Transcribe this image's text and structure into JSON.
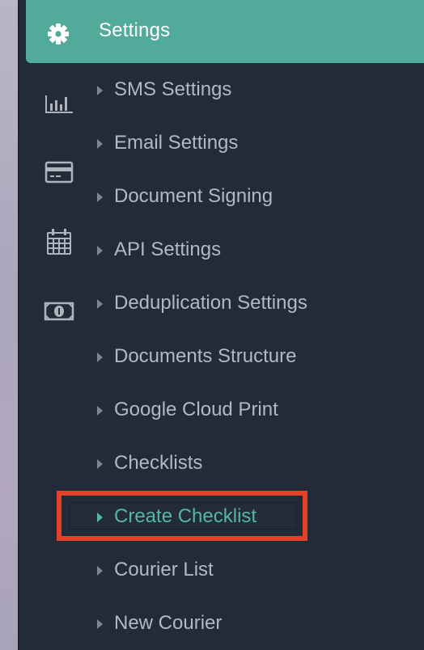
{
  "colors": {
    "sidebar_bg": "#232b39",
    "header_bg": "#52ab9a",
    "menu_text": "#b3b8c2",
    "active_text": "#52b8a4",
    "highlight_border": "#e5402a"
  },
  "header": {
    "title": "Settings",
    "icon": "gear-icon"
  },
  "side_icons": [
    "bar-chart-icon",
    "credit-card-icon",
    "calendar-icon",
    "money-bill-icon"
  ],
  "menu": {
    "items": [
      {
        "label": "SMS Settings",
        "active": false
      },
      {
        "label": "Email Settings",
        "active": false
      },
      {
        "label": "Document Signing",
        "active": false
      },
      {
        "label": "API Settings",
        "active": false
      },
      {
        "label": "Deduplication Settings",
        "active": false
      },
      {
        "label": "Documents Structure",
        "active": false
      },
      {
        "label": "Google Cloud Print",
        "active": false
      },
      {
        "label": "Checklists",
        "active": false
      },
      {
        "label": "Create Checklist",
        "active": true
      },
      {
        "label": "Courier List",
        "active": false
      },
      {
        "label": "New Courier",
        "active": false
      }
    ]
  }
}
